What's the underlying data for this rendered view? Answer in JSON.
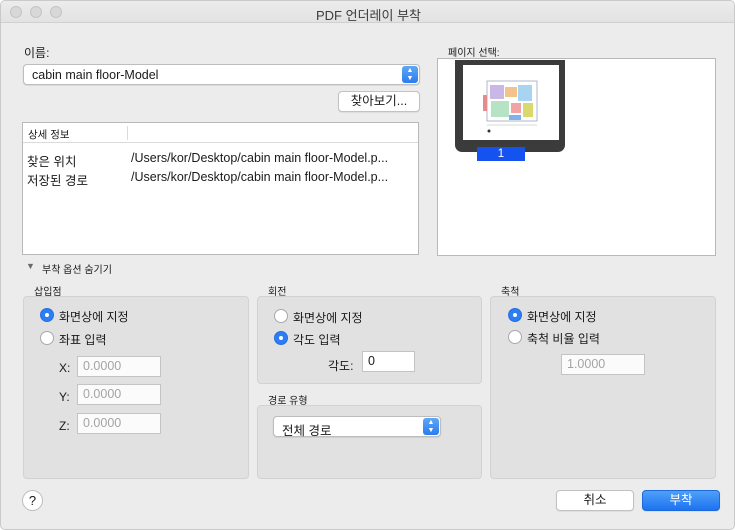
{
  "window": {
    "title": "PDF 언더레이 부착"
  },
  "name": {
    "label": "이름:",
    "value": "cabin main floor-Model"
  },
  "browse_button": "찾아보기...",
  "details": {
    "header": "상세 정보",
    "rows": [
      {
        "key": "찾은 위치",
        "value": "/Users/kor/Desktop/cabin main floor-Model.p..."
      },
      {
        "key": "저장된 경로",
        "value": "/Users/kor/Desktop/cabin main floor-Model.p..."
      }
    ]
  },
  "page_select": {
    "label": "페이지 선택:",
    "pages": [
      "1"
    ]
  },
  "options_toggle": {
    "label": "부착 옵션 숨기기",
    "arrow": "▼"
  },
  "insertion": {
    "title": "삽입점",
    "options": [
      "화면상에 지정",
      "좌표 입력"
    ],
    "selected": 0,
    "fields": [
      {
        "label": "X:",
        "value": "0.0000"
      },
      {
        "label": "Y:",
        "value": "0.0000"
      },
      {
        "label": "Z:",
        "value": "0.0000"
      }
    ]
  },
  "rotation": {
    "title": "회전",
    "options": [
      "화면상에 지정",
      "각도 입력"
    ],
    "selected": 1,
    "angle_label": "각도:",
    "angle_value": "0"
  },
  "path_type": {
    "title": "경로 유형",
    "value": "전체 경로"
  },
  "scale": {
    "title": "축척",
    "options": [
      "화면상에 지정",
      "축척 비율 입력"
    ],
    "selected": 0,
    "value": "1.0000"
  },
  "buttons": {
    "help": "?",
    "cancel": "취소",
    "attach": "부착"
  },
  "colors": {
    "accent": "#2d7ef4",
    "page_badge": "#1553f0"
  }
}
